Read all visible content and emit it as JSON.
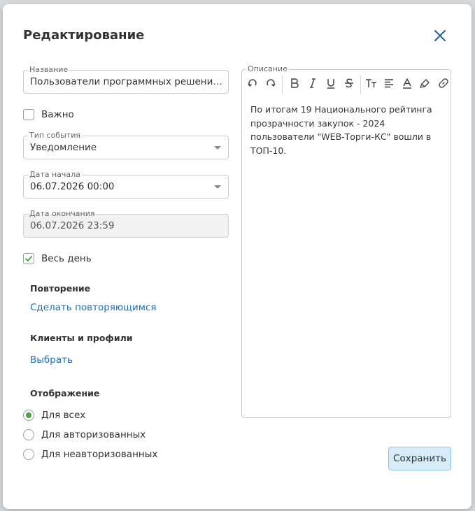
{
  "dialog": {
    "title": "Редактирование"
  },
  "form": {
    "name": {
      "label": "Название",
      "value": "Пользователи программных решений \"К..."
    },
    "important": {
      "label": "Важно",
      "checked": false
    },
    "event_type": {
      "label": "Тип события",
      "value": "Уведомление"
    },
    "start_date": {
      "label": "Дата начала",
      "value": "06.07.2026 00:00"
    },
    "end_date": {
      "label": "Дата окончания",
      "value": "06.07.2026 23:59"
    },
    "all_day": {
      "label": "Весь день",
      "checked": true
    },
    "repeat": {
      "heading": "Повторение",
      "link": "Сделать повторяющимся"
    },
    "clients": {
      "heading": "Клиенты и профили",
      "link": "Выбрать"
    },
    "display": {
      "heading": "Отображение",
      "options": [
        {
          "label": "Для всех",
          "selected": true
        },
        {
          "label": "Для авторизованных",
          "selected": false
        },
        {
          "label": "Для неавторизованных",
          "selected": false
        }
      ]
    }
  },
  "description": {
    "label": "Описание",
    "toolbar": [
      "undo-icon",
      "redo-icon",
      "bold-icon",
      "italic-icon",
      "underline-icon",
      "strikethrough-icon",
      "text-size-icon",
      "align-icon",
      "font-color-icon",
      "highlight-icon",
      "link-icon"
    ],
    "text": "По итогам 19 Национального рейтинга прозрачности закупок - 2024 пользователи \"WEB-Торги-КС\" вошли в ТОП-10."
  },
  "actions": {
    "save_label": "Сохранить"
  },
  "colors": {
    "link": "#1a6fc4",
    "accent_green": "#4aa33f",
    "save_bg": "#d7ebf8",
    "close_icon": "#1f5f9e"
  }
}
